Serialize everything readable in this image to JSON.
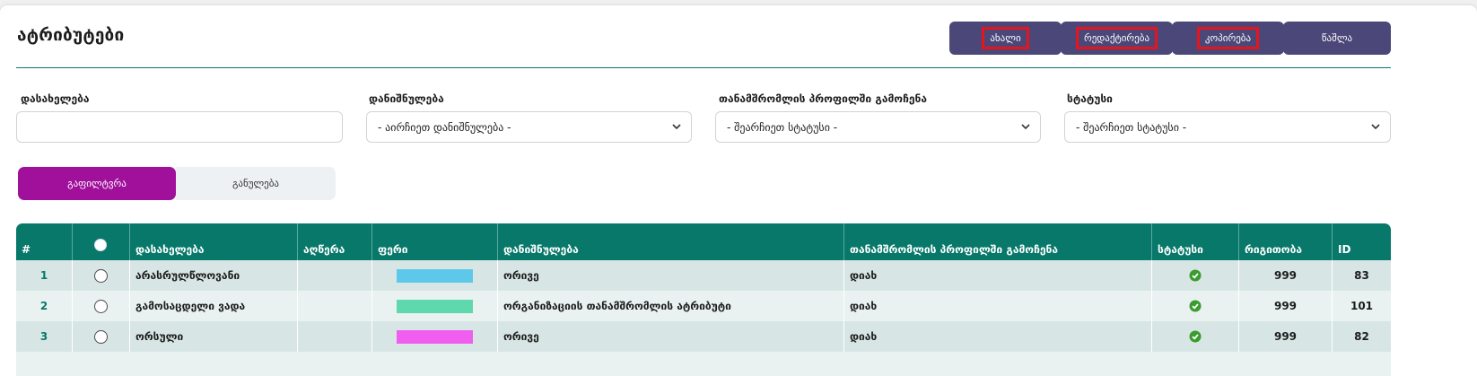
{
  "page": {
    "title": "ატრიბუტები"
  },
  "toolbar": {
    "buttons": [
      {
        "label": "ახალი",
        "highlighted": true
      },
      {
        "label": "რედაქტირება",
        "highlighted": true
      },
      {
        "label": "კოპირება",
        "highlighted": true
      },
      {
        "label": "წაშლა",
        "highlighted": false
      }
    ],
    "button_color": "#4b4779"
  },
  "filters": {
    "name": {
      "label": "დასახელება",
      "value": ""
    },
    "purpose": {
      "label": "დანიშნულება",
      "value": "- აირჩიეთ დანიშნულება -"
    },
    "profile_usage": {
      "label": "თანამშრომლის პროფილში გამოჩენა",
      "value": "- შეარჩიეთ სტატუსი -"
    },
    "status": {
      "label": "სტატუსი",
      "value": "- შეარჩიეთ სტატუსი -"
    }
  },
  "actions": {
    "filter_label": "გაფილტვრა",
    "reset_label": "განულება",
    "filter_color": "#a0109b"
  },
  "table": {
    "header_color": "#07786a",
    "columns": [
      "#",
      "",
      "დასახელება",
      "აღწერა",
      "ფერი",
      "დანიშნულება",
      "თანამშრომლის პროფილში გამოჩენა",
      "სტატუსი",
      "რიგითობა",
      "ID"
    ],
    "rows": [
      {
        "num": "1",
        "name": "არასრულწლოვანი",
        "description": "",
        "color": "#5ec8ea",
        "purpose": "ორივე",
        "profile_usage": "დიახ",
        "status": "active",
        "order": "999",
        "id": "83"
      },
      {
        "num": "2",
        "name": "გამოსაცდელი ვადა",
        "description": "",
        "color": "#5fd8ae",
        "purpose": "ორგანიზაციის თანამშრომლის ატრიბუტი",
        "profile_usage": "დიახ",
        "status": "active",
        "order": "999",
        "id": "101"
      },
      {
        "num": "3",
        "name": "ორსული",
        "description": "",
        "color": "#f05ef0",
        "purpose": "ორივე",
        "profile_usage": "დიახ",
        "status": "active",
        "order": "999",
        "id": "82"
      }
    ],
    "status_icon": "check-circle-icon",
    "status_color": "#3a9b2e"
  }
}
